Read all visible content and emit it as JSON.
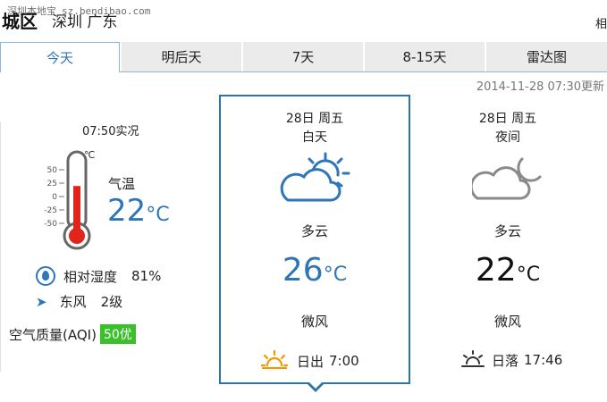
{
  "header": {
    "title_main": "城区",
    "title_sub": "深圳 广东",
    "watermark_text": "深圳本地宝",
    "watermark_site": "sz.bendibao.com",
    "top_right": "相"
  },
  "tabs": [
    {
      "label": "今天",
      "active": true
    },
    {
      "label": "明后天",
      "active": false
    },
    {
      "label": "7天",
      "active": false
    },
    {
      "label": "8-15天",
      "active": false
    },
    {
      "label": "雷达图",
      "active": false
    }
  ],
  "update_time": "2014-11-28 07:30更新",
  "current": {
    "obs_time": "07:50实况",
    "thermo_unit": "℃",
    "thermo_scale": [
      "50",
      "25",
      "0",
      "-25",
      "-50"
    ],
    "thermo_level": 0.62,
    "temp_label": "气温",
    "temp_value": "22",
    "temp_unit": "°C",
    "humidity_label": "相对湿度",
    "humidity_value": "81%",
    "wind_dir": "东风",
    "wind_level": "2级",
    "aqi_label": "空气质量(AQI)",
    "aqi_value": "50优"
  },
  "day": {
    "date": "28日 周五",
    "period": "白天",
    "weather": "多云",
    "temp": "26",
    "temp_unit": "°C",
    "wind": "微风",
    "sun_label": "日出",
    "sun_time": "7:00",
    "icon": "partly-cloudy-day-icon"
  },
  "night": {
    "date": "28日 周五",
    "period": "夜间",
    "weather": "多云",
    "temp": "22",
    "temp_unit": "°C",
    "wind": "微风",
    "sun_label": "日落",
    "sun_time": "17:46",
    "icon": "partly-cloudy-night-icon"
  },
  "colors": {
    "accent": "#2f76b8",
    "card_border": "#2e74a8",
    "aqi_good": "#3bc02b",
    "thermo_red": "#e1251b",
    "sun_orange": "#f39800"
  }
}
